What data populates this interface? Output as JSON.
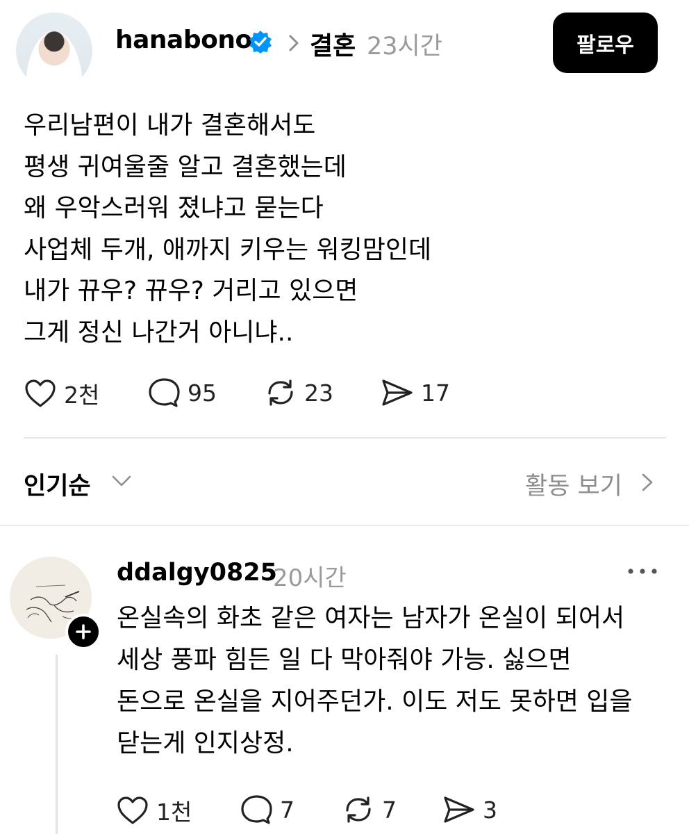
{
  "post": {
    "username": "hanabono",
    "topic": "결혼",
    "time": "23시간",
    "follow_label": "팔로우",
    "lines": [
      "우리남편이 내가 결혼해서도",
      "평생 귀여울줄 알고 결혼했는데",
      "왜 우악스러워 졌냐고 묻는다",
      "사업체 두개, 애까지 키우는 워킹맘인데",
      "내가 뀨우? 뀨우? 거리고 있으면",
      "그게 정신 나간거 아니냐.."
    ],
    "stats": {
      "likes": "2천",
      "comments": "95",
      "reposts": "23",
      "shares": "17"
    }
  },
  "sort": {
    "label": "인기순",
    "activity_label": "활동 보기"
  },
  "comment": {
    "username": "ddalgy0825",
    "time": "20시간",
    "lines": [
      "온실속의 화초 같은 여자는 남자가 온실이 되어서",
      "세상 풍파 힘든 일 다 막아줘야 가능. 싫으면",
      "돈으로 온실을 지어주던가. 이도 저도 못하면 입을",
      "닫는게 인지상정."
    ],
    "stats": {
      "likes": "1천",
      "comments": "7",
      "reposts": "7",
      "shares": "3"
    }
  },
  "colors": {
    "verified": "#0095f6",
    "muted": "#9a9a9a",
    "button_bg": "#000000"
  }
}
